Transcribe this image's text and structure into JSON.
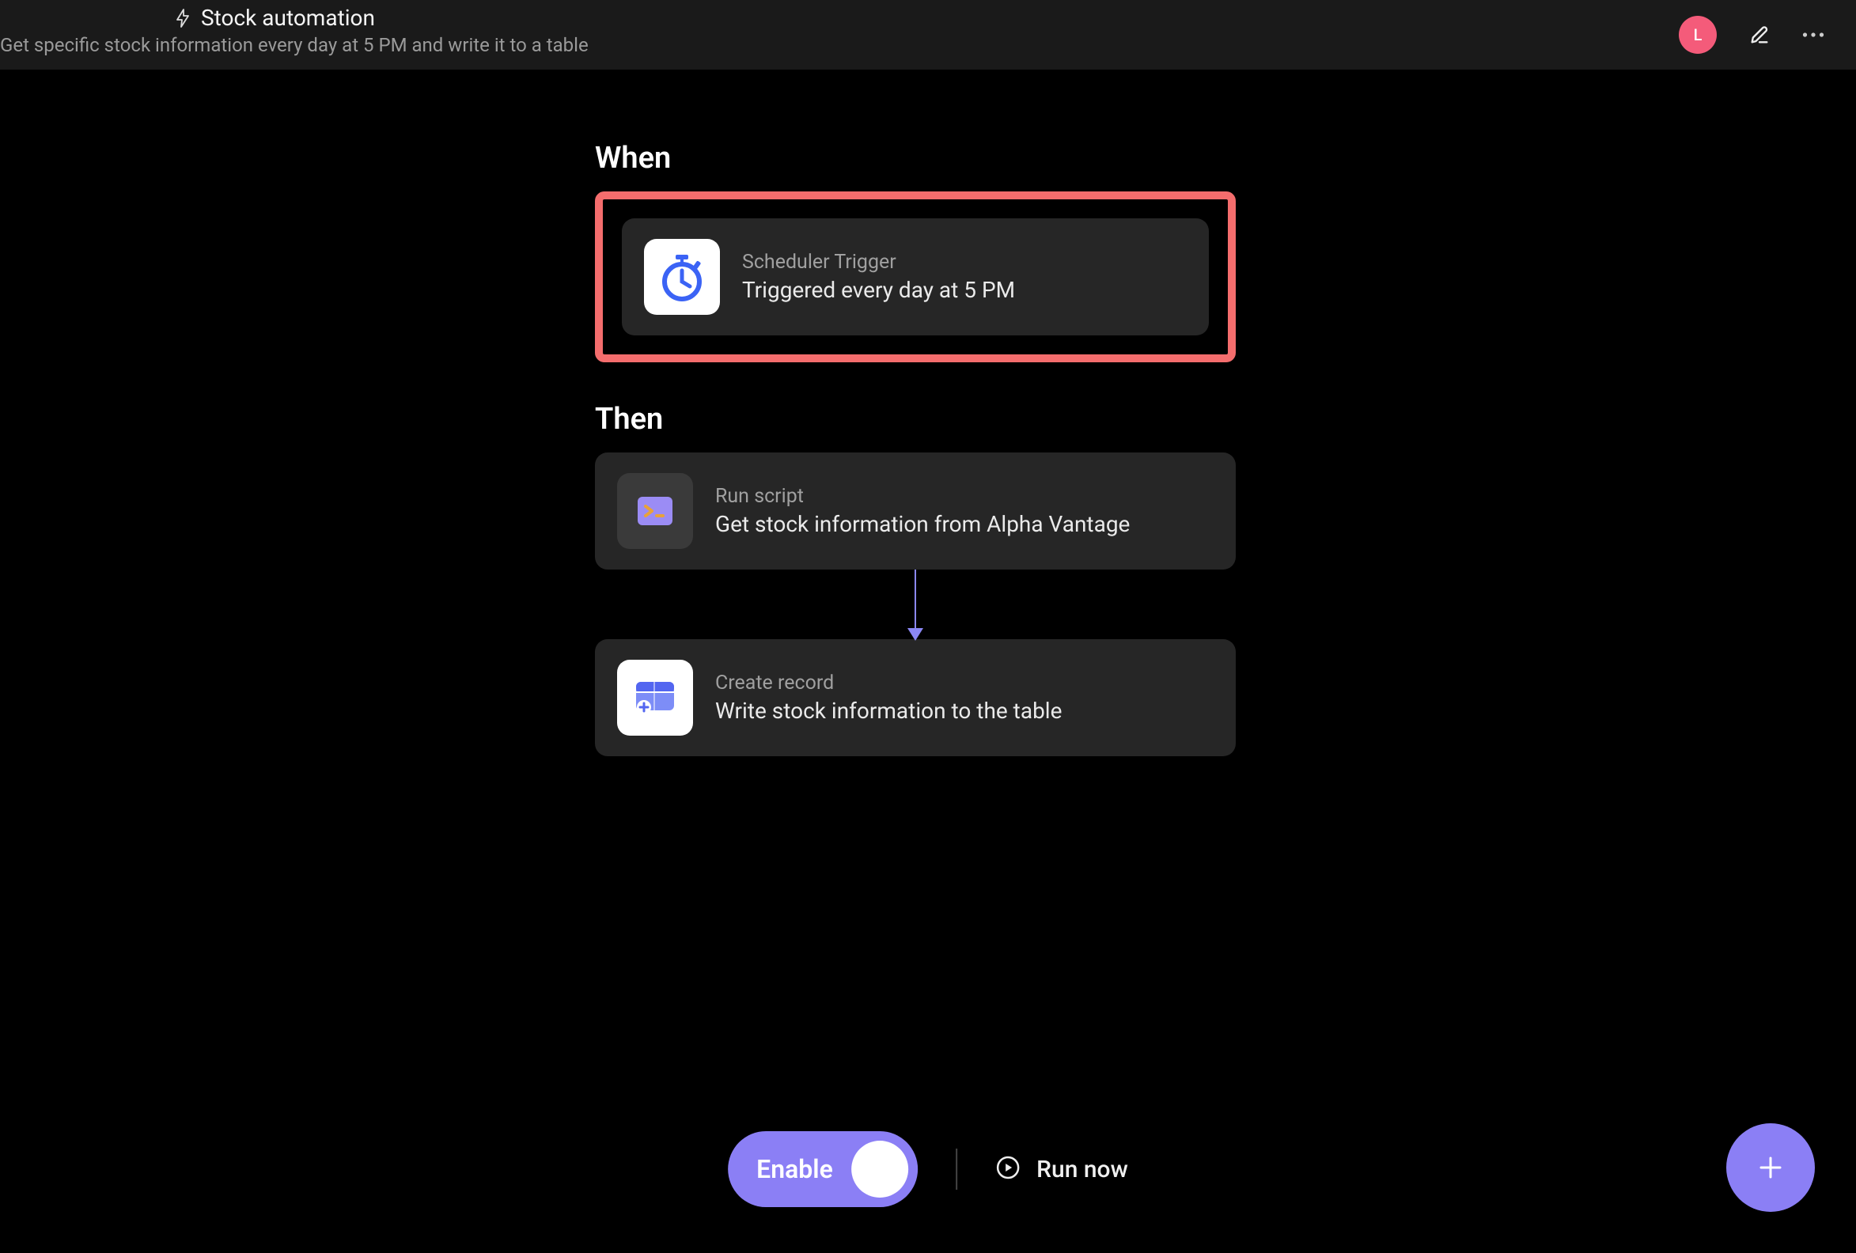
{
  "header": {
    "title": "Stock automation",
    "subtitle": "Get specific stock information every day at 5 PM and write it to a table",
    "avatar_initial": "L"
  },
  "sections": {
    "when_label": "When",
    "then_label": "Then"
  },
  "steps": {
    "trigger": {
      "icon_name": "stopwatch-icon",
      "title": "Scheduler Trigger",
      "desc": "Triggered every day at 5 PM"
    },
    "script": {
      "icon_name": "terminal-icon",
      "title": "Run script",
      "desc": "Get stock information from Alpha Vantage"
    },
    "record": {
      "icon_name": "table-add-icon",
      "title": "Create record",
      "desc": "Write stock information to the table"
    }
  },
  "footer": {
    "enable_label": "Enable",
    "run_now_label": "Run now"
  },
  "colors": {
    "accent": "#8b7ff5",
    "highlight": "#f46d6d",
    "avatar": "#f45b7a"
  }
}
